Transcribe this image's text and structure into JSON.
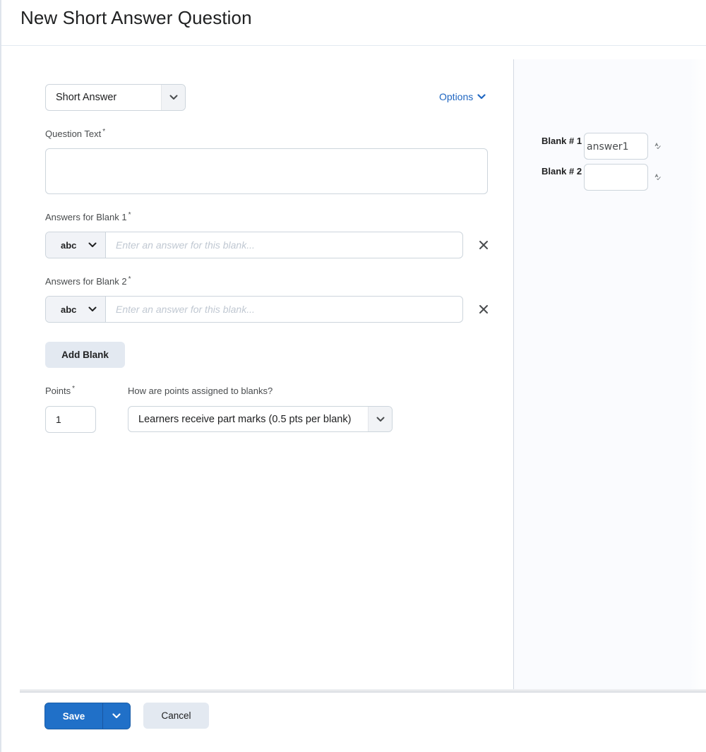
{
  "header": {
    "title": "New Short Answer Question"
  },
  "question_type": {
    "selected": "Short Answer"
  },
  "options": {
    "label": "Options"
  },
  "question_text": {
    "label": "Question Text",
    "required_mark": "*",
    "value": ""
  },
  "answers": [
    {
      "label": "Answers for Blank 1",
      "required_mark": "*",
      "type": "abc",
      "placeholder": "Enter an answer for this blank...",
      "value": ""
    },
    {
      "label": "Answers for Blank 2",
      "required_mark": "*",
      "type": "abc",
      "placeholder": "Enter an answer for this blank...",
      "value": ""
    }
  ],
  "add_blank": {
    "label": "Add Blank"
  },
  "points": {
    "label": "Points",
    "required_mark": "*",
    "value": "1"
  },
  "assignment": {
    "label": "How are points assigned to blanks?",
    "selected": "Learners receive part marks (0.5 pts per blank)"
  },
  "preview": {
    "blanks": [
      {
        "label": "Blank # 1",
        "value": "answer1"
      },
      {
        "label": "Blank # 2",
        "value": ""
      }
    ]
  },
  "footer": {
    "save_label": "Save",
    "cancel_label": "Cancel"
  },
  "colors": {
    "primary": "#2070c8",
    "link": "#1f66c1",
    "secondary_button": "#e3e9f1",
    "panel_bg": "#fafbfe"
  }
}
